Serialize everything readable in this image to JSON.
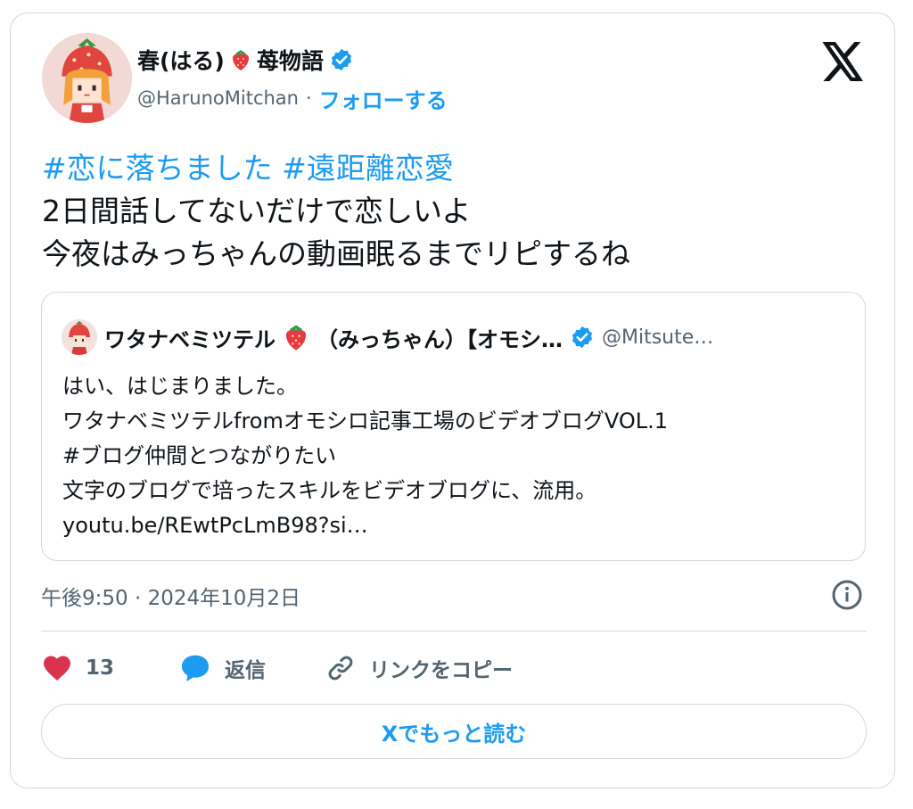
{
  "author": {
    "display_name": "春(はる)",
    "display_name_suffix": "苺物語",
    "handle": "@HarunoMitchan",
    "separator": "·",
    "follow_label": "フォローする"
  },
  "tweet": {
    "hashtag_1": "#恋に落ちました",
    "hashtag_2": "#遠距離恋愛",
    "line_2": "2日間話してないだけで恋しいよ",
    "line_3": "今夜はみっちゃんの動画眠るまでリピするね"
  },
  "quote": {
    "name": "ワタナベミツテル",
    "name_suffix": "（みっちゃん）【オモシ…",
    "handle": "@Mitsute…",
    "lines": [
      "はい、はじまりました。",
      "ワタナベミツテルfromオモシロ記事工場のビデオブログVOL.1",
      "#ブログ仲間とつながりたい",
      "文字のブログで培ったスキルをビデオブログに、流用。",
      "youtu.be/REwtPcLmB98?si…"
    ]
  },
  "timestamp": "午後9:50 · 2024年10月2日",
  "actions": {
    "like_count": "13",
    "reply_label": "返信",
    "copy_link_label": "リンクをコピー"
  },
  "read_more_label": "Xでもっと読む",
  "colors": {
    "accent": "#1d9bf0",
    "text": "#0f1419",
    "secondary": "#536471",
    "like": "#f91880",
    "border": "#cfd9de"
  },
  "icons": {
    "logo": "x-logo-icon",
    "verified": "verified-badge-icon",
    "like": "heart-icon",
    "reply": "speech-bubble-icon",
    "link": "link-icon",
    "info": "info-icon"
  }
}
